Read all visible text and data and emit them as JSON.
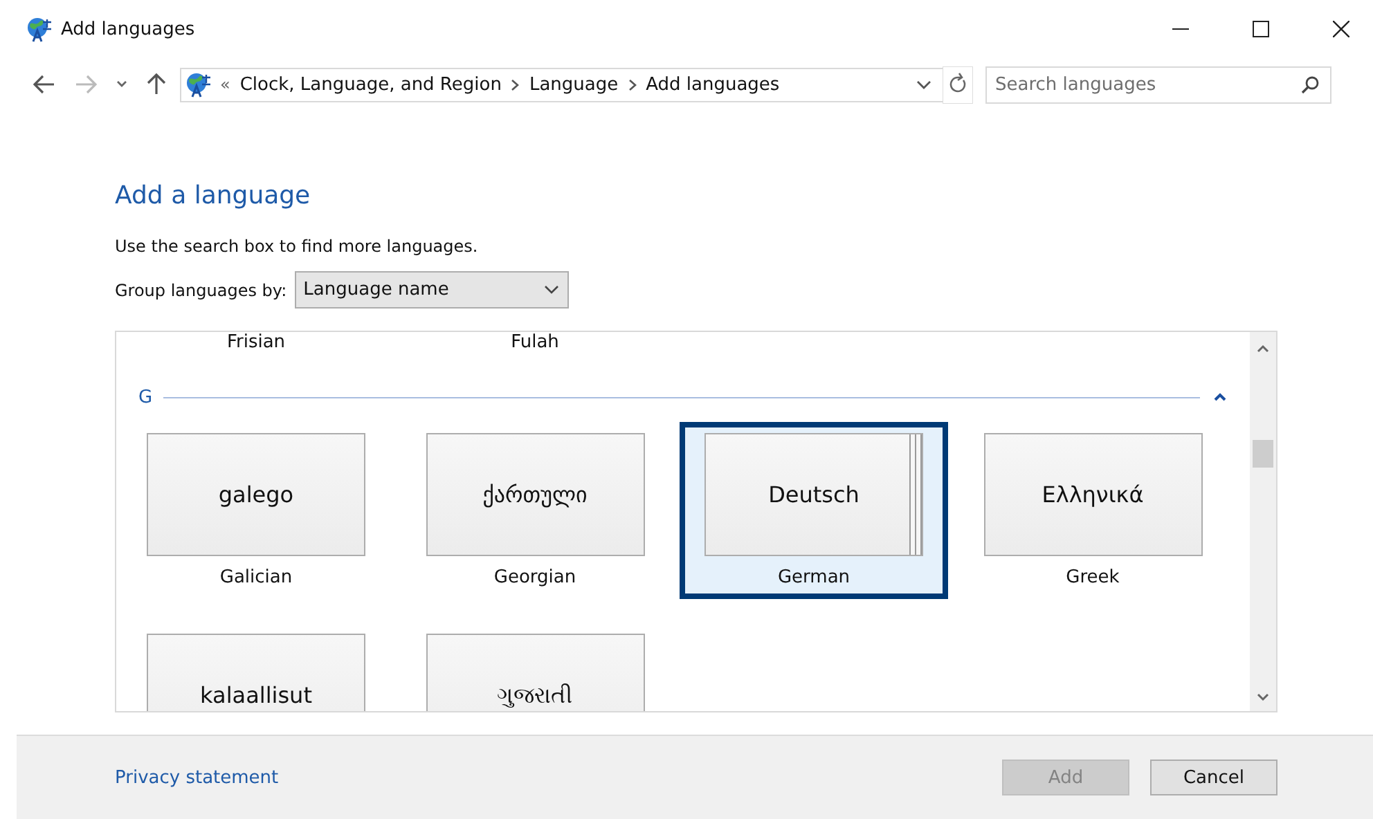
{
  "window": {
    "title": "Add languages"
  },
  "address_bar": {
    "overflow": "«",
    "breadcrumb": [
      "Clock, Language, and Region",
      "Language",
      "Add languages"
    ]
  },
  "search": {
    "placeholder": "Search languages"
  },
  "heading": "Add a language",
  "hint": "Use the search box to find more languages.",
  "group_by": {
    "label": "Group languages by:",
    "value": "Language name"
  },
  "language_list": {
    "previous_row": [
      "Frisian",
      "Fulah"
    ],
    "groups": [
      {
        "letter": "G",
        "expanded": true,
        "tiles": [
          {
            "native": "galego",
            "name": "Galician",
            "selected": false,
            "stacked": false
          },
          {
            "native": "ქართული",
            "name": "Georgian",
            "selected": false,
            "stacked": false
          },
          {
            "native": "Deutsch",
            "name": "German",
            "selected": true,
            "stacked": true
          },
          {
            "native": "Ελληνικά",
            "name": "Greek",
            "selected": false,
            "stacked": false
          },
          {
            "native": "kalaallisut",
            "selected": false,
            "stacked": false
          },
          {
            "native": "ગુજરાતી",
            "selected": false,
            "stacked": false
          }
        ]
      }
    ]
  },
  "footer": {
    "link": "Privacy statement",
    "buttons": [
      {
        "label": "Add",
        "disabled": true
      },
      {
        "label": "Cancel",
        "disabled": false
      }
    ]
  }
}
